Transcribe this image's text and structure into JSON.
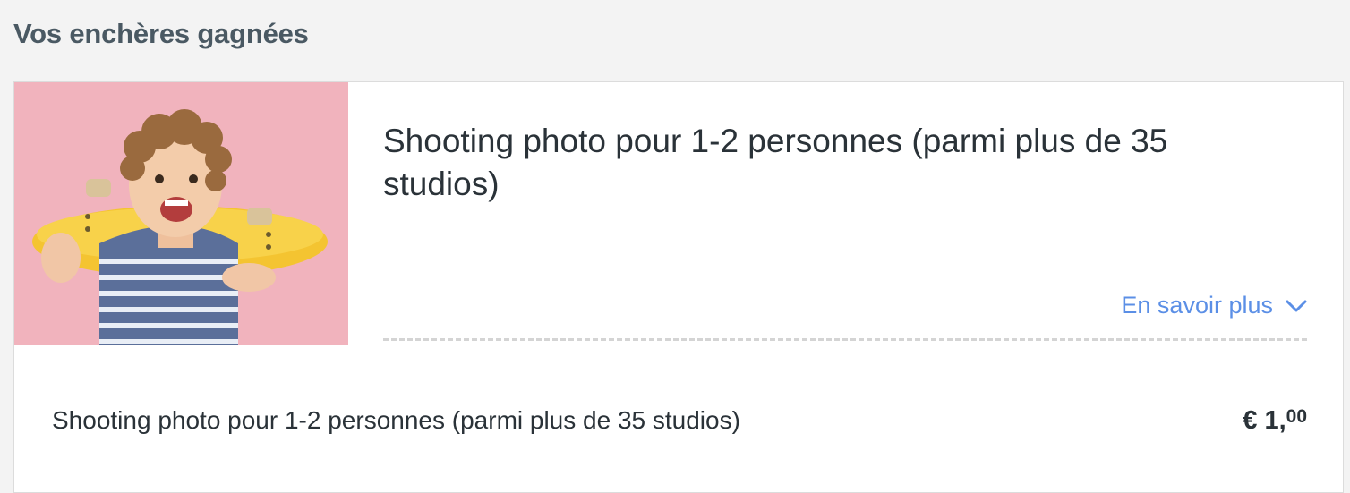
{
  "section": {
    "title": "Vos enchères gagnées"
  },
  "item": {
    "title": "Shooting photo pour 1-2 personnes (parmi plus de 35 studios)",
    "image_alt": "product-photo",
    "more_link": {
      "label": "En savoir plus",
      "icon": "chevron-down-icon"
    },
    "line": {
      "label": "Shooting photo pour 1-2 personnes (parmi plus de 35 studios)",
      "currency": "€",
      "price_main": "1,",
      "price_cents": "00"
    }
  },
  "colors": {
    "background": "#f3f3f3",
    "section_title": "#4a5963",
    "link": "#5b8fe6",
    "image_bg": "#f1b3bd",
    "skateboard": "#f4c431"
  }
}
